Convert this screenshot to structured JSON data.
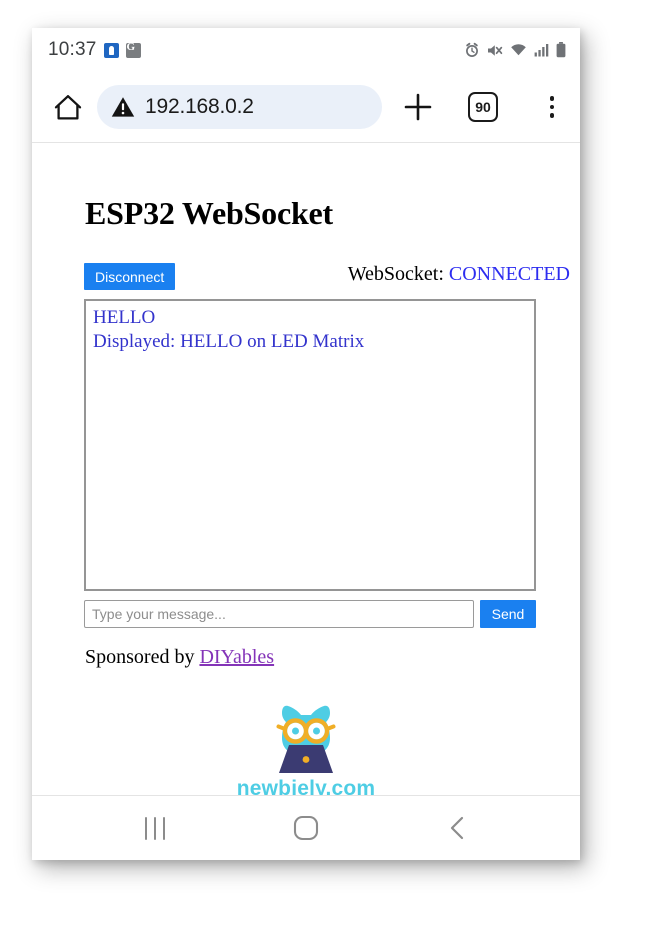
{
  "status_bar": {
    "clock": "10:37",
    "left_icons": [
      "app-icon-blue",
      "google-translate-icon"
    ],
    "right_icons": [
      "alarm-icon",
      "mute-icon",
      "wifi-icon",
      "signal-icon",
      "battery-icon"
    ]
  },
  "browser": {
    "home_icon": "home-icon",
    "security_icon": "warning-triangle-icon",
    "url": "192.168.0.2",
    "new_tab_icon": "plus-icon",
    "tab_count": "90",
    "menu_icon": "overflow-menu-icon"
  },
  "page": {
    "title": "ESP32 WebSocket",
    "watermark": "newbiely.com",
    "connection": {
      "button_label": "Disconnect",
      "status_label": "WebSocket:",
      "status_value": "CONNECTED",
      "status_color": "#2d2df0",
      "button_color": "#1a80f0"
    },
    "log": {
      "lines": [
        "HELLO",
        "Displayed: HELLO on LED Matrix"
      ],
      "text_color": "#3333cc"
    },
    "composer": {
      "input_value": "",
      "input_placeholder": "Type your message...",
      "send_label": "Send"
    },
    "sponsor": {
      "prefix": "Sponsored by ",
      "link_label": "DIYables",
      "link_color": "#8434b8"
    },
    "logo": {
      "alt": "owl-with-laptop-logo",
      "caption": "newbiely.com",
      "caption_color": "#4ecde4",
      "owl_color": "#4ecde4",
      "glasses_color": "#f0ae26",
      "laptop_color": "#3b3b72"
    }
  },
  "nav_bar": {
    "recents_label": "recents-icon",
    "home_label": "home-icon",
    "back_label": "back-icon"
  }
}
